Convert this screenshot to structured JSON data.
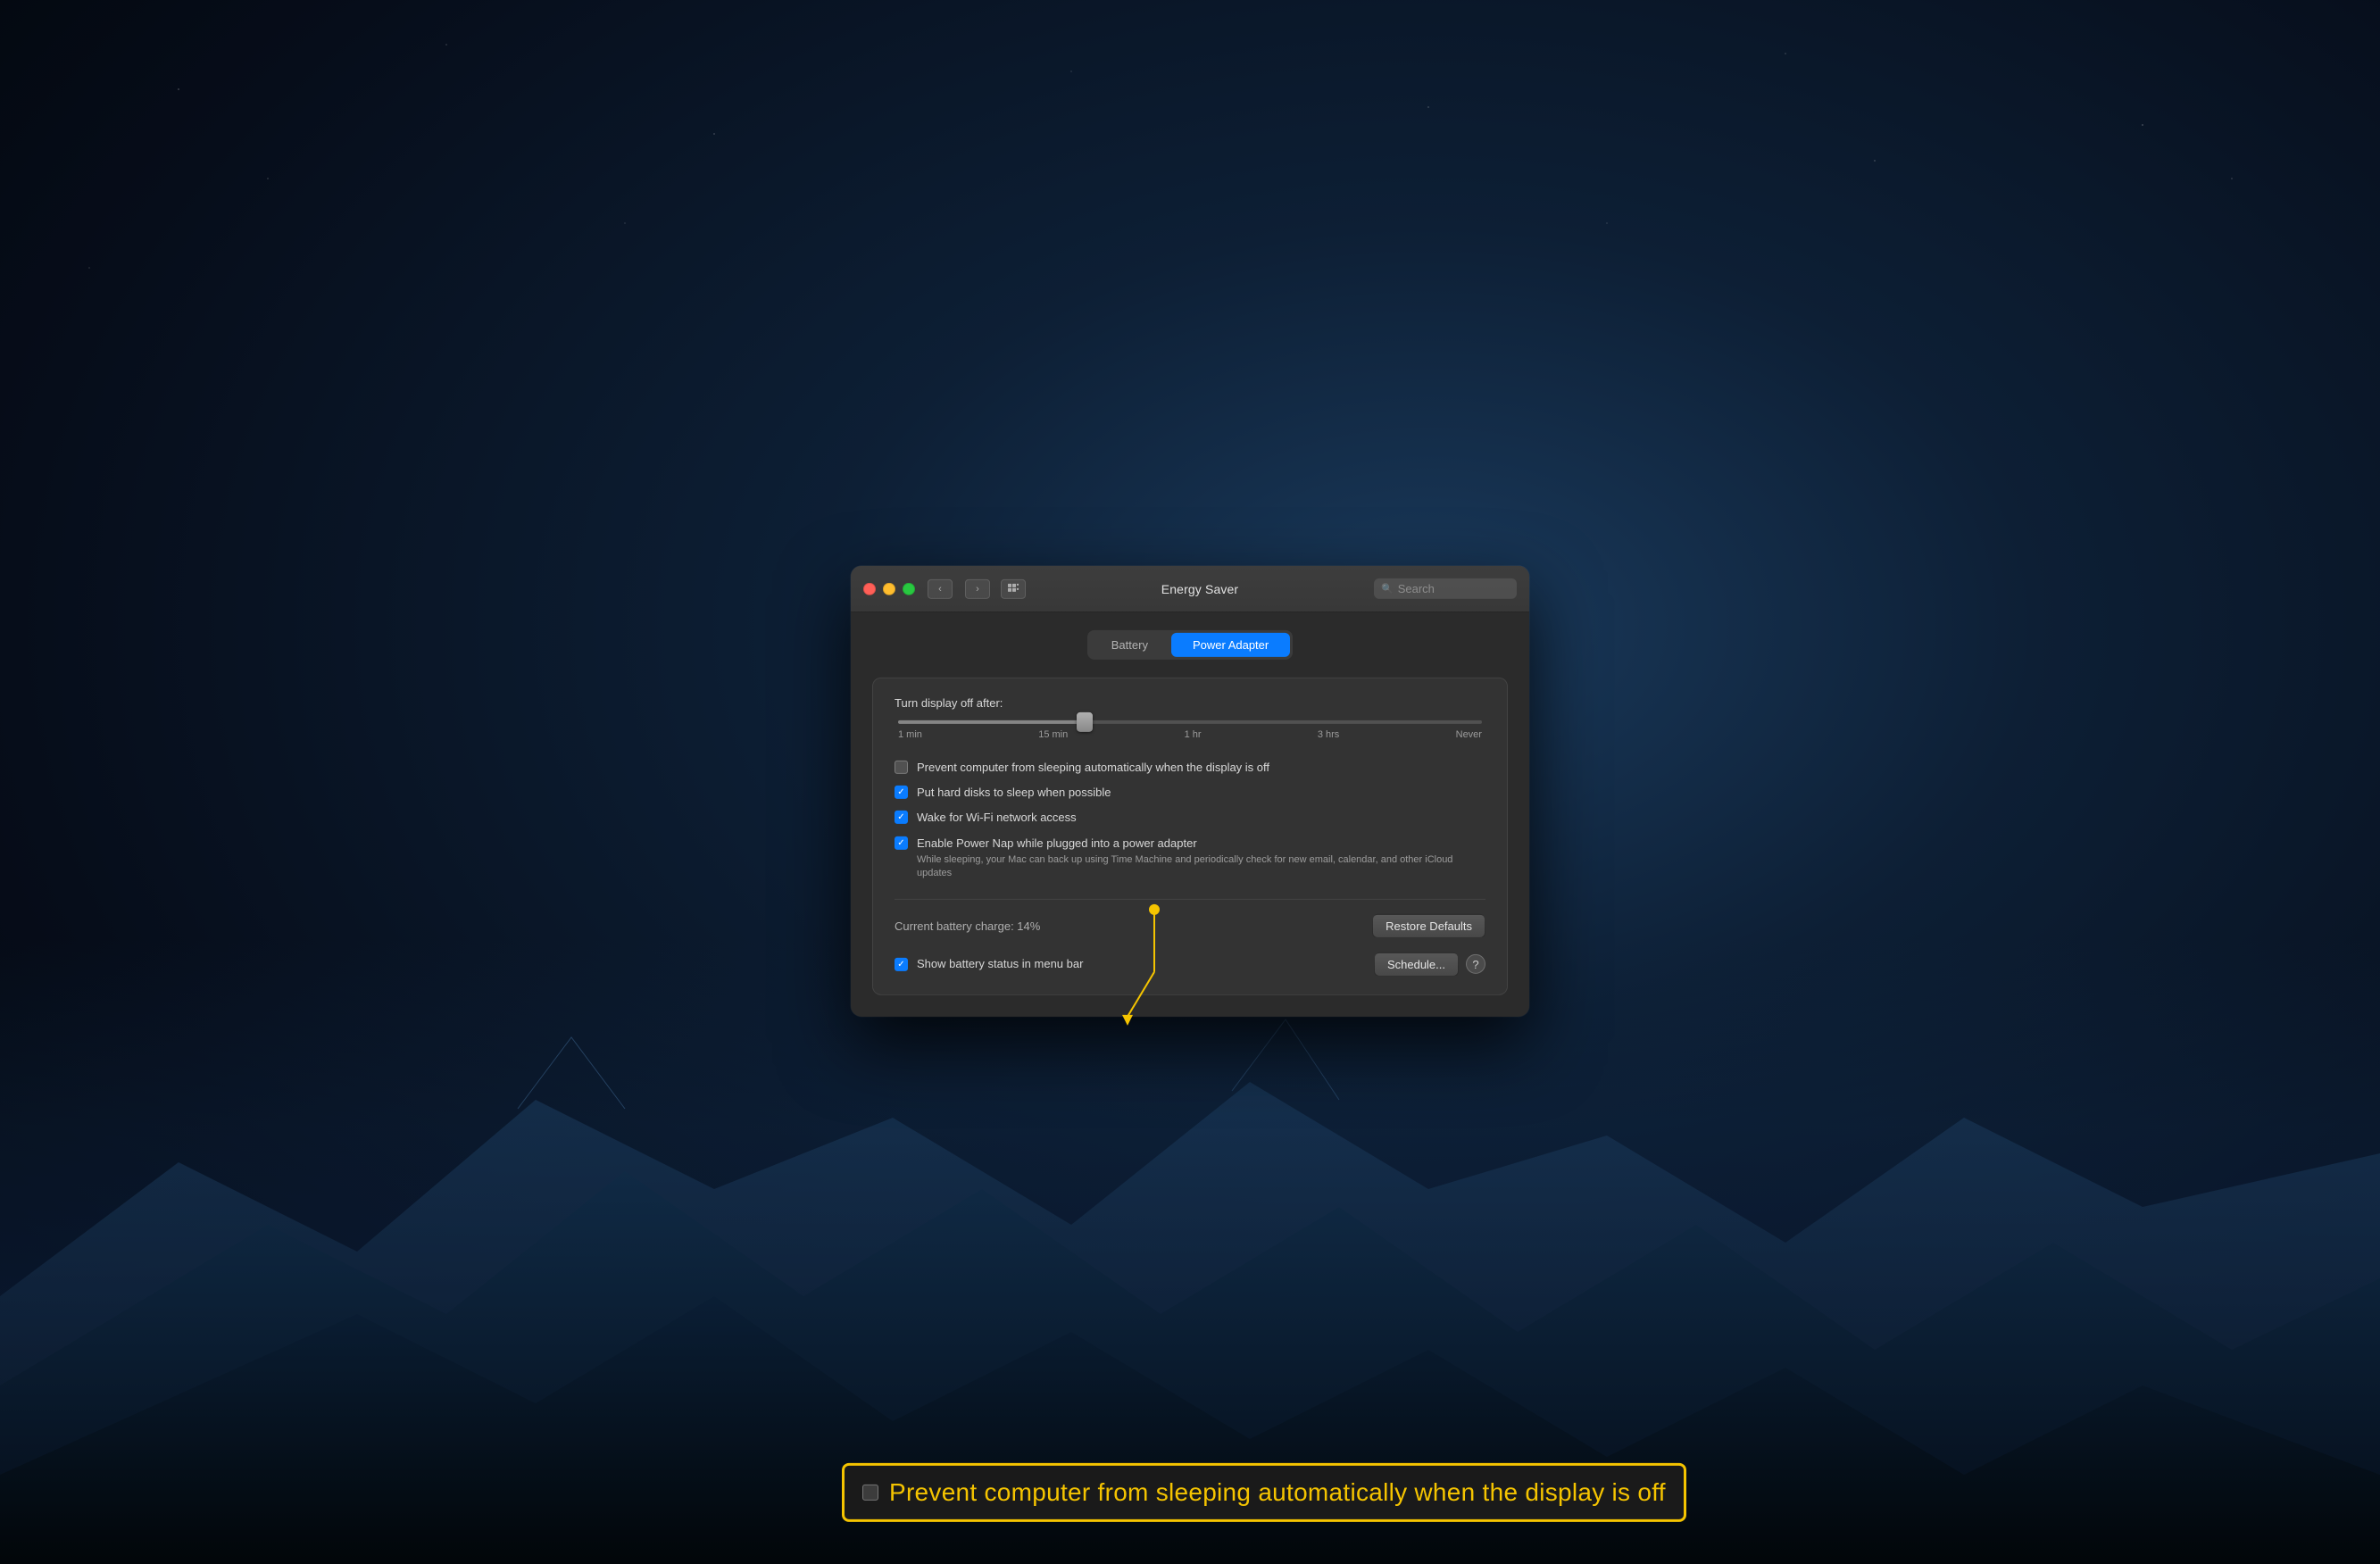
{
  "window": {
    "title": "Energy Saver",
    "search_placeholder": "Search"
  },
  "titlebar": {
    "back_label": "‹",
    "forward_label": "›",
    "grid_label": "⊞"
  },
  "tabs": [
    {
      "id": "battery",
      "label": "Battery",
      "active": false
    },
    {
      "id": "power-adapter",
      "label": "Power Adapter",
      "active": true
    }
  ],
  "slider": {
    "label": "Turn display off after:",
    "marks": [
      "1 min",
      "15 min",
      "1 hr",
      "3 hrs",
      "Never"
    ]
  },
  "checkboxes": [
    {
      "id": "prevent-sleep",
      "label": "Prevent computer from sleeping automatically when the display is off",
      "checked": false,
      "sublabel": ""
    },
    {
      "id": "hard-disks",
      "label": "Put hard disks to sleep when possible",
      "checked": true,
      "sublabel": ""
    },
    {
      "id": "wifi",
      "label": "Wake for Wi-Fi network access",
      "checked": true,
      "sublabel": ""
    },
    {
      "id": "power-nap",
      "label": "Enable Power Nap while plugged into a power adapter",
      "checked": true,
      "sublabel": "While sleeping, your Mac can back up using Time Machine and periodically check for new email, calendar, and other iCloud updates"
    }
  ],
  "battery": {
    "status_label": "Current battery charge: 14%",
    "restore_button": "Restore Defaults"
  },
  "show_battery": {
    "checkbox_label": "Show battery status in menu bar",
    "checked": true
  },
  "schedule_button": "Schedule...",
  "help_button": "?",
  "callout": {
    "text": "Prevent computer from sleeping automatically when the display is off"
  }
}
